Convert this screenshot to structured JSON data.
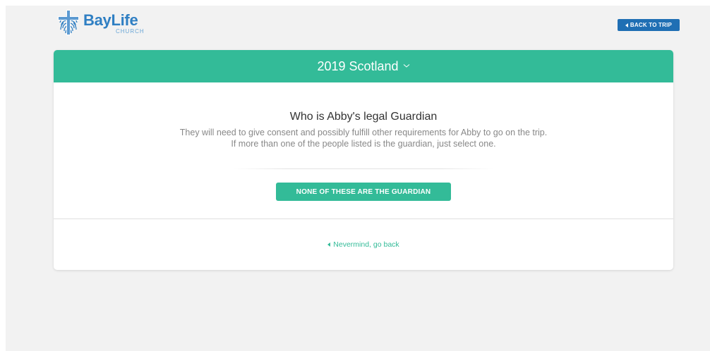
{
  "brand": {
    "name_part1": "Bay",
    "name_part2": "Life",
    "sub": "CHURCH",
    "colors": {
      "blue": "#2f7fc3",
      "light_blue": "#6aa6d6"
    }
  },
  "header": {
    "back_to_trip_label": "BACK TO TRIP"
  },
  "card": {
    "trip_title": "2019 Scotland",
    "question": "Who is Abby's legal Guardian",
    "description_line1": "They will need to give consent and possibly fulfill other requirements for Abby to go on the trip.",
    "description_line2": "If more than one of the people listed is the guardian, just select one.",
    "none_button_label": "NONE OF THESE ARE THE GUARDIAN",
    "go_back_label": "Nevermind, go back"
  },
  "colors": {
    "accent_green": "#33bb98",
    "button_blue": "#1f6fb4",
    "background": "#f2f2f2"
  },
  "icons": {
    "logo": "cross-fingerprint-icon",
    "back_caret": "caret-left-icon",
    "title_chevron": "chevron-down-icon",
    "go_back_caret": "caret-left-icon"
  }
}
